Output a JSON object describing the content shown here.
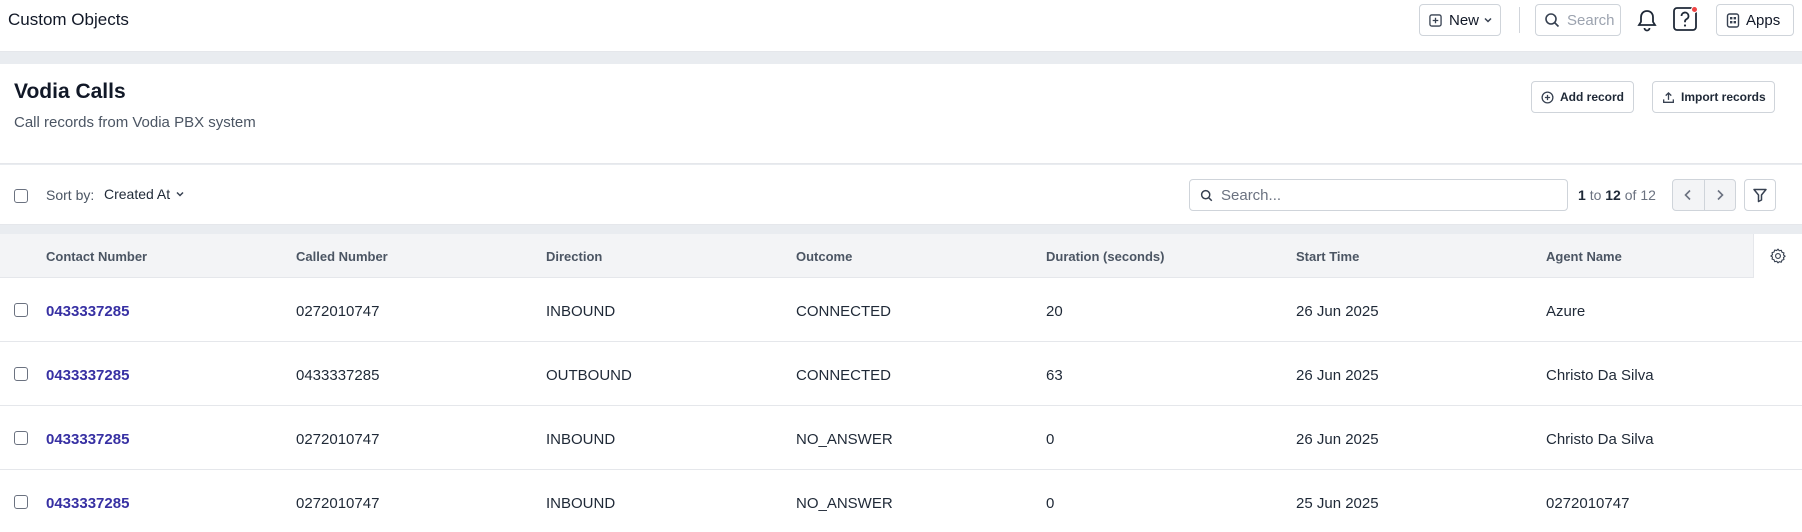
{
  "app": {
    "title": "Custom Objects",
    "new_label": "New",
    "search_placeholder": "Search",
    "apps_label": "Apps"
  },
  "page": {
    "title": "Vodia Calls",
    "subtitle": "Call records from Vodia PBX system",
    "add_record_label": "Add record",
    "import_records_label": "Import records"
  },
  "toolbar": {
    "sort_label": "Sort by:",
    "sort_value": "Created At",
    "search_placeholder": "Search...",
    "pager": {
      "from": "1",
      "to_word": "to",
      "to": "12",
      "of_word": "of",
      "total": "12"
    }
  },
  "table": {
    "columns": [
      "Contact Number",
      "Called Number",
      "Direction",
      "Outcome",
      "Duration (seconds)",
      "Start Time",
      "Agent Name"
    ],
    "rows": [
      {
        "contact": "0433337285",
        "called": "0272010747",
        "direction": "INBOUND",
        "outcome": "CONNECTED",
        "duration": "20",
        "start": "26 Jun 2025",
        "agent": "Azure"
      },
      {
        "contact": "0433337285",
        "called": "0433337285",
        "direction": "OUTBOUND",
        "outcome": "CONNECTED",
        "duration": "63",
        "start": "26 Jun 2025",
        "agent": "Christo Da Silva"
      },
      {
        "contact": "0433337285",
        "called": "0272010747",
        "direction": "INBOUND",
        "outcome": "NO_ANSWER",
        "duration": "0",
        "start": "26 Jun 2025",
        "agent": "Christo Da Silva"
      },
      {
        "contact": "0433337285",
        "called": "0272010747",
        "direction": "INBOUND",
        "outcome": "NO_ANSWER",
        "duration": "0",
        "start": "25 Jun 2025",
        "agent": "0272010747"
      }
    ]
  },
  "colors": {
    "link": "#3730a3",
    "notification_dot": "#ef4444",
    "page_background": "#e9ecf0"
  },
  "icons": [
    "plus-square-icon",
    "chevron-down-icon",
    "search-icon",
    "bell-icon",
    "help-icon",
    "apps-icon",
    "plus-circle-icon",
    "upload-icon",
    "chevron-left-icon",
    "chevron-right-icon",
    "filter-icon",
    "gear-icon"
  ]
}
